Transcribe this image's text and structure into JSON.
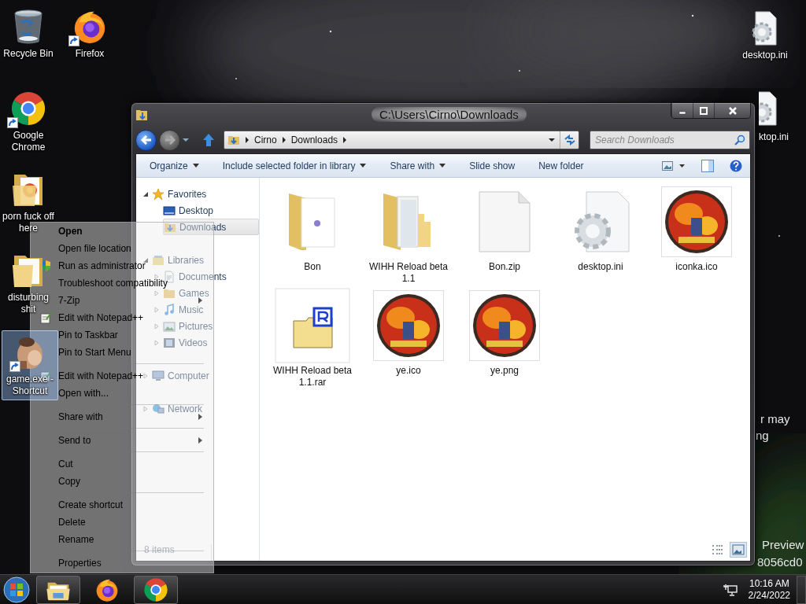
{
  "desktop": {
    "icons": [
      {
        "label": "Recycle Bin",
        "kind": "recycle_bin",
        "shortcut": false,
        "selected": false
      },
      {
        "label": "Firefox",
        "kind": "firefox",
        "shortcut": true,
        "selected": false
      },
      {
        "label": "Google Chrome",
        "kind": "chrome",
        "shortcut": true,
        "selected": false
      },
      {
        "label": "porn fuck off here",
        "kind": "folder_media",
        "shortcut": false,
        "selected": false
      },
      {
        "label": "disturbing shit",
        "kind": "folder",
        "shortcut": false,
        "selected": false
      },
      {
        "label": "game.exe - Shortcut",
        "kind": "app",
        "shortcut": true,
        "selected": true
      },
      {
        "label": "desktop.ini",
        "kind": "settings_file",
        "shortcut": false,
        "selected": false
      },
      {
        "label": "ktop.ini",
        "kind": "settings_file",
        "shortcut": false,
        "selected": false
      }
    ],
    "watermark": [
      "r may",
      "ng",
      "Preview",
      "8056cd0"
    ]
  },
  "explorer": {
    "title": "C:\\Users\\Cirno\\Downloads",
    "breadcrumb": [
      "Cirno",
      "Downloads"
    ],
    "search": {
      "placeholder": "Search Downloads"
    },
    "toolbar": [
      {
        "label": "Organize",
        "dropdown": true
      },
      {
        "label": "Include selected folder in library",
        "dropdown": true
      },
      {
        "label": "Share with",
        "dropdown": true
      },
      {
        "label": "Slide show",
        "dropdown": false
      },
      {
        "label": "New folder",
        "dropdown": false
      }
    ],
    "nav": [
      {
        "label": "Favorites",
        "kind": "star",
        "expanded": true,
        "selected": false,
        "children": [
          {
            "label": "Desktop",
            "kind": "desktop",
            "selected": false
          },
          {
            "label": "Downloads",
            "kind": "downloads",
            "selected": true
          }
        ]
      },
      {
        "label": "Libraries",
        "kind": "libraries",
        "expanded": true,
        "selected": false,
        "children": [
          {
            "label": "Documents",
            "kind": "documents",
            "expanded": false,
            "selected": false
          },
          {
            "label": "Games",
            "kind": "games",
            "expanded": false,
            "selected": false
          },
          {
            "label": "Music",
            "kind": "music",
            "expanded": false,
            "selected": false
          },
          {
            "label": "Pictures",
            "kind": "pictures",
            "expanded": false,
            "selected": false
          },
          {
            "label": "Videos",
            "kind": "videos",
            "expanded": false,
            "selected": false
          }
        ]
      },
      {
        "label": "Computer",
        "kind": "computer",
        "expanded": false,
        "selected": false
      },
      {
        "label": "Network",
        "kind": "network",
        "expanded": false,
        "selected": false
      }
    ],
    "files": [
      {
        "name": "Bon",
        "kind": "folder_doc"
      },
      {
        "name": "WIHH Reload beta 1.1",
        "kind": "folder_files"
      },
      {
        "name": "Bon.zip",
        "kind": "blank_file"
      },
      {
        "name": "desktop.ini",
        "kind": "settings_file"
      },
      {
        "name": "iconka.ico",
        "kind": "picture"
      },
      {
        "name": "WIHH Reload beta 1.1.rar",
        "kind": "rar"
      },
      {
        "name": "ye.ico",
        "kind": "picture"
      },
      {
        "name": "ye.png",
        "kind": "picture"
      }
    ],
    "status": "8 items"
  },
  "context_menu": {
    "items": [
      {
        "kind": "item",
        "label": "Open",
        "default": true,
        "submenu": false
      },
      {
        "kind": "item",
        "label": "Open file location",
        "default": false,
        "submenu": false
      },
      {
        "kind": "admin_item",
        "label": "Run as administrator",
        "default": false,
        "submenu": false
      },
      {
        "kind": "item",
        "label": "Troubleshoot compatibility",
        "default": false,
        "submenu": false
      },
      {
        "kind": "item",
        "label": "7-Zip",
        "default": false,
        "submenu": true
      },
      {
        "kind": "notepad_item",
        "label": "Edit with Notepad++",
        "default": false,
        "submenu": false
      },
      {
        "kind": "item",
        "label": "Pin to Taskbar",
        "default": false,
        "submenu": false
      },
      {
        "kind": "item",
        "label": "Pin to Start Menu",
        "default": false,
        "submenu": false
      },
      {
        "kind": "separator"
      },
      {
        "kind": "notepad_item",
        "label": "Edit with Notepad++",
        "default": false,
        "submenu": false
      },
      {
        "kind": "item",
        "label": "Open with...",
        "default": false,
        "submenu": false
      },
      {
        "kind": "separator"
      },
      {
        "kind": "item",
        "label": "Share with",
        "default": false,
        "submenu": true
      },
      {
        "kind": "separator"
      },
      {
        "kind": "item",
        "label": "Send to",
        "default": false,
        "submenu": true
      },
      {
        "kind": "separator"
      },
      {
        "kind": "item",
        "label": "Cut",
        "default": false,
        "submenu": false
      },
      {
        "kind": "item",
        "label": "Copy",
        "default": false,
        "submenu": false
      },
      {
        "kind": "separator"
      },
      {
        "kind": "item",
        "label": "Create shortcut",
        "default": false,
        "submenu": false
      },
      {
        "kind": "item",
        "label": "Delete",
        "default": false,
        "submenu": false
      },
      {
        "kind": "item",
        "label": "Rename",
        "default": false,
        "submenu": false
      },
      {
        "kind": "separator"
      },
      {
        "kind": "item",
        "label": "Properties",
        "default": false,
        "submenu": false
      }
    ]
  },
  "taskbar": {
    "apps": [
      {
        "kind": "explorer",
        "running": true
      },
      {
        "kind": "firefox",
        "running": false
      },
      {
        "kind": "chrome",
        "running": true
      }
    ],
    "time": "10:16 AM",
    "date": "2/24/2022"
  }
}
